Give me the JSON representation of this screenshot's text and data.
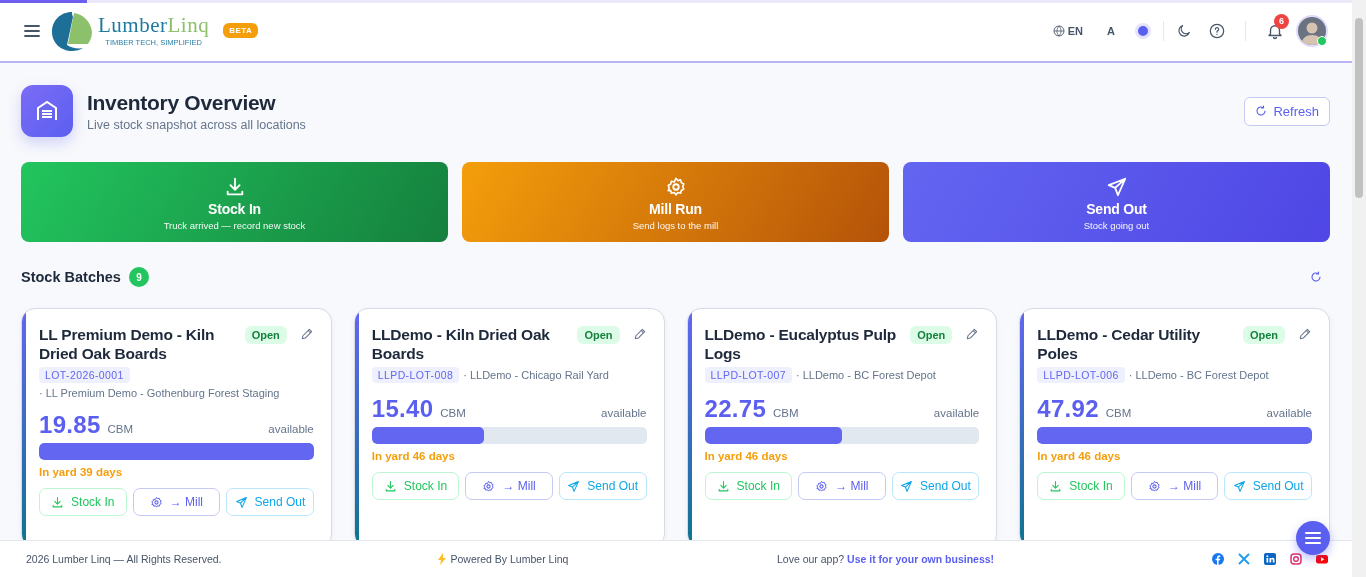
{
  "header": {
    "loading": {
      "level": 0.064
    },
    "brand_parts": [
      "Lumber",
      "Linq"
    ],
    "tagline": "TIMBER TECH, SIMPLIFIED",
    "badge": "BETA",
    "language": "EN",
    "font_size": "A",
    "notifications": "6"
  },
  "page": {
    "title": "Inventory Overview",
    "subtitle": "Live stock snapshot across all locations",
    "refresh": "Refresh"
  },
  "actions": [
    {
      "kind": "stock_in",
      "title": "Stock In",
      "subtitle": "Truck arrived — record new stock"
    },
    {
      "kind": "mill",
      "title": "Mill Run",
      "subtitle": "Send logs to the mill"
    },
    {
      "kind": "send_out",
      "title": "Send Out",
      "subtitle": "Stock going out"
    }
  ],
  "batches": {
    "title": "Stock Batches",
    "count": "9",
    "items": [
      {
        "name": "LL Premium Demo - Kiln Dried Oak Boards",
        "status": "Open",
        "lot": "LOT-2026-0001",
        "location": "· LL Premium Demo - Gothenburg Forest Staging",
        "quantity": "19.85",
        "unit": "CBM",
        "availability": "available",
        "level": 1.0,
        "age": "In yard 39 days",
        "buttons": [
          {
            "kind": "stock_in",
            "label": "Stock In"
          },
          {
            "kind": "mill",
            "label": "→ Mill"
          },
          {
            "kind": "send_out",
            "label": "Send Out"
          }
        ]
      },
      {
        "name": "LLDemo - Kiln Dried Oak Boards",
        "status": "Open",
        "lot": "LLPD-LOT-008",
        "location": "· LLDemo - Chicago Rail Yard",
        "quantity": "15.40",
        "unit": "CBM",
        "availability": "available",
        "level": 0.41,
        "age": "In yard 46 days",
        "buttons": [
          {
            "kind": "stock_in",
            "label": "Stock In"
          },
          {
            "kind": "mill",
            "label": "→ Mill"
          },
          {
            "kind": "send_out",
            "label": "Send Out"
          }
        ]
      },
      {
        "name": "LLDemo - Eucalyptus Pulp Logs",
        "status": "Open",
        "lot": "LLPD-LOT-007",
        "location": "· LLDemo - BC Forest Depot",
        "quantity": "22.75",
        "unit": "CBM",
        "availability": "available",
        "level": 0.5,
        "age": "In yard 46 days",
        "buttons": [
          {
            "kind": "stock_in",
            "label": "Stock In"
          },
          {
            "kind": "mill",
            "label": "→ Mill"
          },
          {
            "kind": "send_out",
            "label": "Send Out"
          }
        ]
      },
      {
        "name": "LLDemo - Cedar Utility Poles",
        "status": "Open",
        "lot": "LLPD-LOT-006",
        "location": "· LLDemo - BC Forest Depot",
        "quantity": "47.92",
        "unit": "CBM",
        "availability": "available",
        "level": 1.0,
        "age": "In yard 46 days",
        "buttons": [
          {
            "kind": "stock_in",
            "label": "Stock In"
          },
          {
            "kind": "mill",
            "label": "→ Mill"
          },
          {
            "kind": "send_out",
            "label": "Send Out"
          }
        ]
      }
    ]
  },
  "footer": {
    "copyright": "2026 Lumber Linq — All Rights Reserved.",
    "powered": "Powered By Lumber Linq",
    "promo": "Love our app?",
    "promo_link": "Use it for your own business!"
  }
}
